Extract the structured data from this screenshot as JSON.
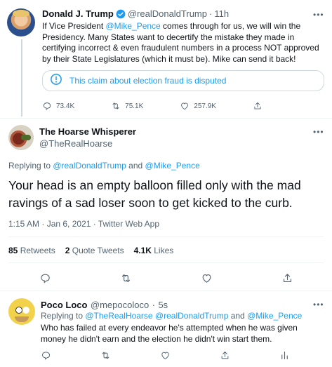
{
  "tweet1": {
    "name": "Donald J. Trump",
    "handle": "@realDonaldTrump",
    "separator": "·",
    "time": "11h",
    "body_a": "If Vice President ",
    "body_mention": "@Mike_Pence",
    "body_b": " comes through for us, we will win the Presidency. Many States want to decertify the mistake they made in certifying incorrect & even fraudulent numbers in a process  NOT approved by their State Legislatures (which it must be). Mike can send it back!",
    "notice": "This claim about election fraud is disputed",
    "replies": "73.4K",
    "retweets": "75.1K",
    "likes": "257.9K",
    "more": "•••"
  },
  "tweet2": {
    "name": "The Hoarse Whisperer",
    "handle": "@TheRealHoarse",
    "more": "•••",
    "replying_prefix": "Replying to ",
    "replying_to_1": "@realDonaldTrump",
    "replying_and": " and ",
    "replying_to_2": "@Mike_Pence",
    "text": "Your head is an empty balloon filled only with the mad ravings of a sad loser soon to get kicked to the curb.",
    "meta": "1:15 AM · Jan 6, 2021 · Twitter Web App",
    "stats": {
      "retweets_count": "85",
      "retweets_label": " Retweets",
      "quotes_count": "2",
      "quotes_label": " Quote Tweets",
      "likes_count": "4.1K",
      "likes_label": " Likes"
    }
  },
  "tweet3": {
    "name": "Poco Loco",
    "handle": "@mepocoloco",
    "separator": "·",
    "time": "5s",
    "more": "•••",
    "replying_prefix": "Replying to ",
    "replying_to": "@TheRealHoarse @realDonaldTrump",
    "replying_and": " and ",
    "replying_to_2": "@Mike_Pence",
    "text": "Who has failed at every endeavor he's attempted when he was given money he didn't earn and the election he didn't win start them."
  },
  "colors": {
    "accent": "#1d9bf0",
    "muted": "#536471",
    "border": "#cfd9de"
  },
  "icons": [
    "verified-badge-icon",
    "info-icon",
    "reply-icon",
    "retweet-icon",
    "like-icon",
    "share-icon",
    "analytics-icon",
    "more-icon"
  ]
}
